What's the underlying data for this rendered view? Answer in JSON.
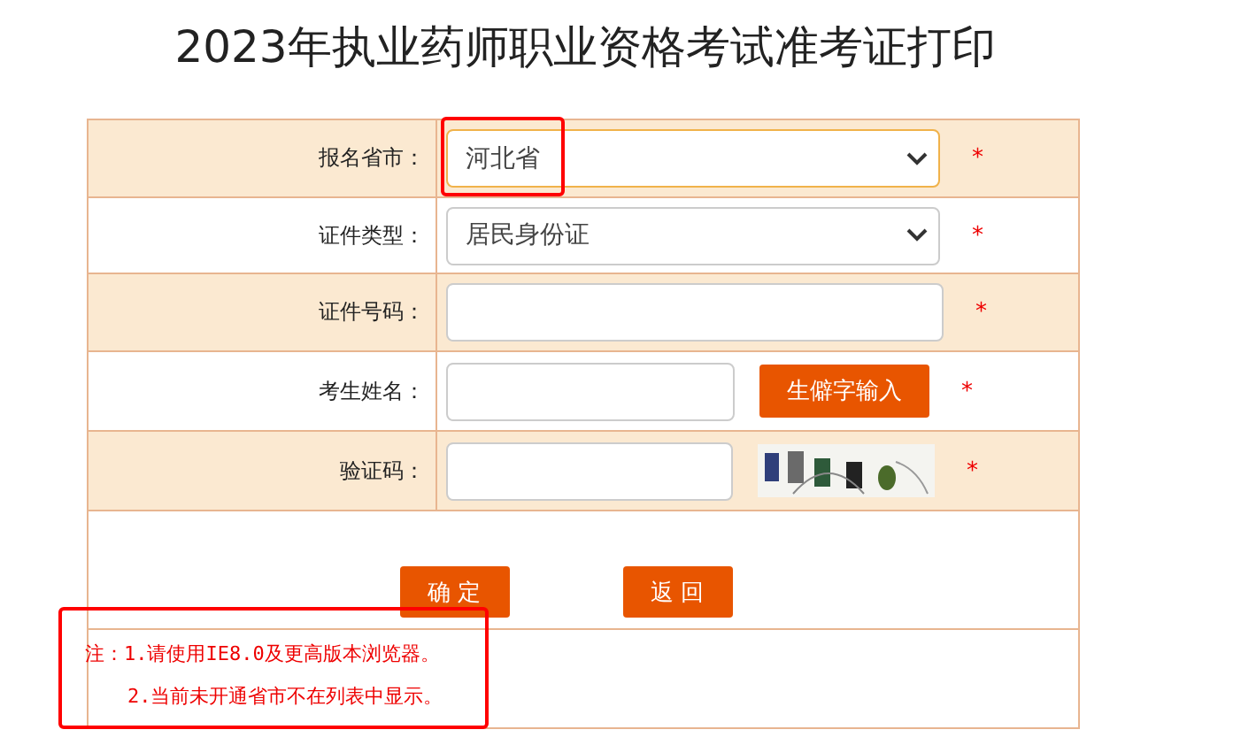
{
  "title": "2023年执业药师职业资格考试准考证打印",
  "fields": [
    {
      "kind": "select",
      "label": "报名省市：",
      "value": "河北省",
      "required": "*",
      "highlighted": true,
      "focused": true
    },
    {
      "kind": "select",
      "label": "证件类型：",
      "value": "居民身份证",
      "required": "*",
      "highlighted": false,
      "focused": false
    },
    {
      "kind": "input",
      "label": "证件号码：",
      "required": "*",
      "highlighted": false,
      "focused": false
    },
    {
      "kind": "input_button",
      "label": "考生姓名：",
      "button": "生僻字输入",
      "required": "*",
      "highlighted": false,
      "focused": false
    },
    {
      "kind": "captcha",
      "label": "验证码：",
      "required": "*",
      "highlighted": false,
      "focused": false
    }
  ],
  "buttons": [
    "确 定",
    "返 回"
  ],
  "notes": {
    "highlighted": true,
    "lines": [
      "注：1.请使用IE8.0及更高版本浏览器。",
      "2.当前未开通省市不在列表中显示。"
    ]
  }
}
